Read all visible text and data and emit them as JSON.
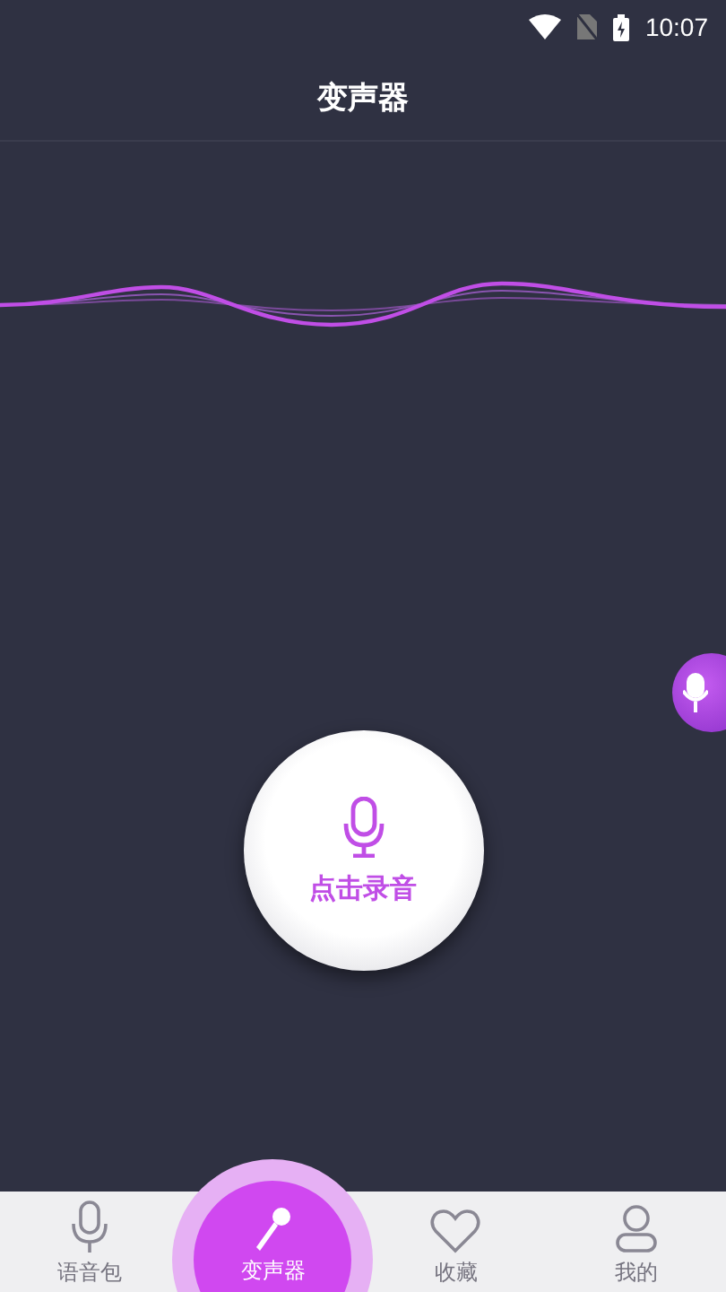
{
  "status_bar": {
    "time": "10:07"
  },
  "title": "变声器",
  "record_button": {
    "label": "点击录音"
  },
  "tabs": [
    {
      "kind": "mic",
      "label": "语音包",
      "selected": false
    },
    {
      "kind": "karaoke",
      "label": "变声器",
      "selected": true
    },
    {
      "kind": "heart",
      "label": "收藏",
      "selected": false
    },
    {
      "kind": "person",
      "label": "我的",
      "selected": false
    }
  ]
}
